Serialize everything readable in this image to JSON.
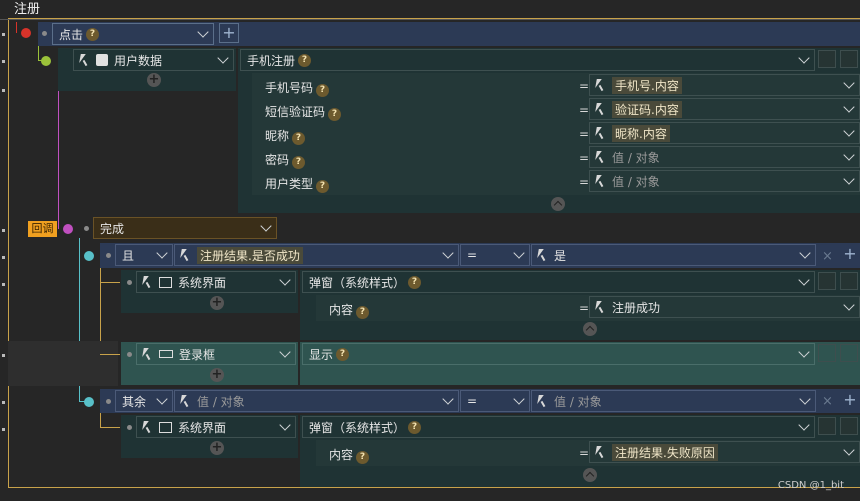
{
  "title": "注册",
  "event": {
    "label": "点击",
    "plus": "+"
  },
  "block1": {
    "target": "用户数据",
    "action": "手机注册"
  },
  "params1": [
    {
      "label": "手机号码",
      "eq": "=",
      "value": "手机号.内容",
      "placeholder": false
    },
    {
      "label": "短信验证码",
      "eq": "=",
      "value": "验证码.内容",
      "placeholder": false
    },
    {
      "label": "昵称",
      "eq": "=",
      "value": "昵称.内容",
      "placeholder": false
    },
    {
      "label": "密码",
      "eq": "=",
      "value": "值 / 对象",
      "placeholder": true
    },
    {
      "label": "用户类型",
      "eq": "=",
      "value": "值 / 对象",
      "placeholder": true
    }
  ],
  "callback": {
    "tag": "回调",
    "label": "完成"
  },
  "cond1": {
    "op": "且",
    "left": "注册结果.是否成功",
    "cmp": "=",
    "right": "是"
  },
  "block2": {
    "target": "系统界面",
    "action": "弹窗（系统样式）",
    "param_label": "内容",
    "eq": "=",
    "param_value": "注册成功"
  },
  "block3": {
    "target": "登录框",
    "action": "显示"
  },
  "cond2": {
    "op": "其余",
    "left": "值 / 对象",
    "cmp": "=",
    "right": "值 / 对象"
  },
  "block4": {
    "target": "系统界面",
    "action": "弹窗（系统样式）",
    "param_label": "内容",
    "eq": "=",
    "param_value": "注册结果.失败原因"
  },
  "watermark": "CSDN @1_bit",
  "icons": {
    "q": "?",
    "plus": "+",
    "x": "×"
  },
  "colors": {
    "red": "#d8332a",
    "green": "#9bc23a",
    "magenta": "#c050c0",
    "cyan": "#58c0c8",
    "accent": "#f0a020"
  }
}
